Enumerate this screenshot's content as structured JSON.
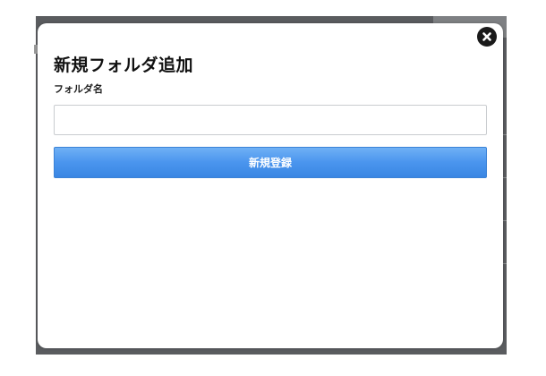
{
  "dialog": {
    "title": "新規フォルダ追加",
    "folder_name_label": "フォルダ名",
    "folder_name_value": "",
    "folder_name_placeholder": "",
    "submit_label": "新規登録",
    "close_icon": "close-circle-icon"
  },
  "colors": {
    "button_blue": "#4a95ee",
    "backdrop": "#5a5c5f",
    "close_icon_bg": "#1a1a1a"
  }
}
